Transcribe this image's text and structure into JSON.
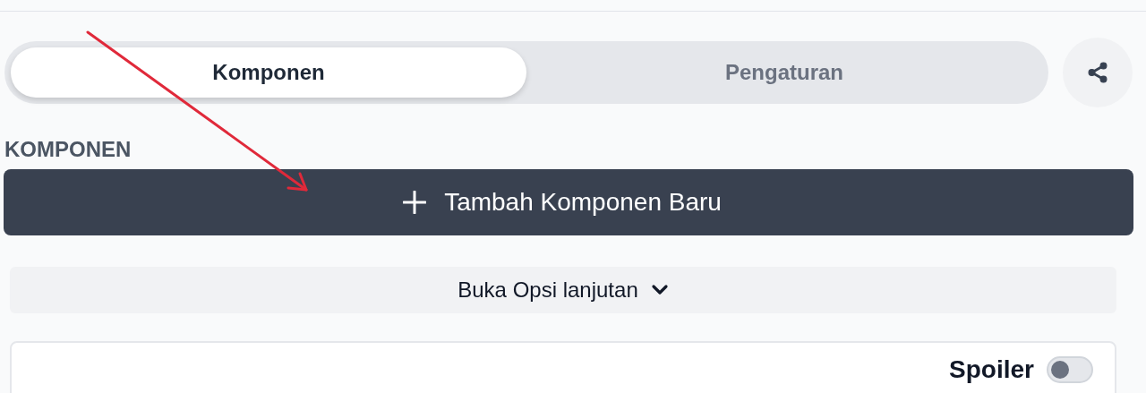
{
  "tabs": [
    {
      "label": "Komponen",
      "selected": true
    },
    {
      "label": "Pengaturan",
      "selected": false
    }
  ],
  "section_title": "KOMPONEN",
  "add_button": {
    "label": "Tambah Komponen Baru"
  },
  "advanced_toggle": {
    "label": "Buka Opsi lanjutan",
    "expanded": false
  },
  "card": {
    "spoiler": {
      "label": "Spoiler",
      "on": false
    }
  }
}
